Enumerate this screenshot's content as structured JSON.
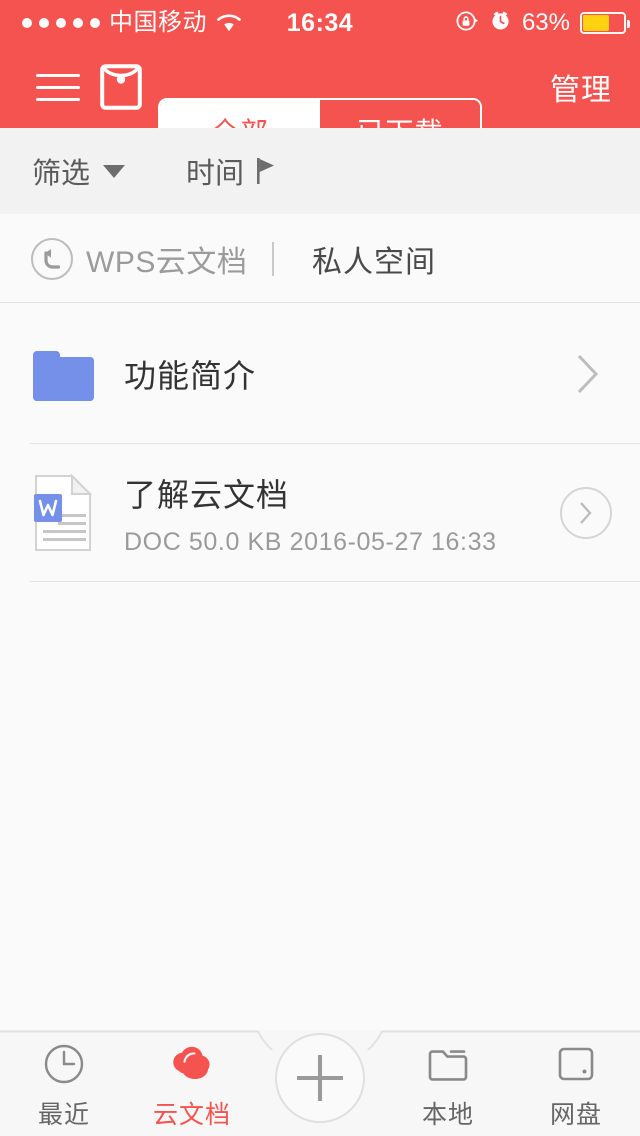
{
  "statusbar": {
    "carrier": "中国移动",
    "time": "16:34",
    "battery_percent": "63%",
    "signal_dots": 5,
    "battery_level": 63,
    "icons": [
      "wifi-icon",
      "rotation-lock-icon",
      "alarm-clock-icon",
      "battery-icon"
    ]
  },
  "navbar": {
    "menu_icon": "hamburger-menu-icon",
    "envelope_icon": "red-envelope-icon",
    "segments": [
      {
        "label": "全部",
        "selected": true
      },
      {
        "label": "已下载",
        "selected": false
      }
    ],
    "manage_label": "管理",
    "background": "#f5534f"
  },
  "filterbar": {
    "filter_label": "筛选",
    "sort_label": "时间"
  },
  "breadcrumb": {
    "back_icon": "back-arrow-icon",
    "root_label": "WPS云文档",
    "separator": "|",
    "current_label": "私人空间"
  },
  "list": {
    "items": [
      {
        "type": "folder",
        "icon": "blue-folder-icon",
        "title": "功能简介",
        "meta": "",
        "accessory": "chevron-right-icon"
      },
      {
        "type": "file",
        "icon": "word-document-icon",
        "title": "了解云文档",
        "meta": "DOC  50.0 KB  2016-05-27 16:33",
        "file_type": "DOC",
        "file_size": "50.0 KB",
        "modified": "2016-05-27 16:33",
        "accessory": "chevron-right-circle-icon"
      }
    ]
  },
  "tabbar": {
    "tabs": [
      {
        "label": "最近",
        "icon": "clock-icon",
        "active": false
      },
      {
        "label": "云文档",
        "icon": "cloud-icon",
        "active": true
      },
      {
        "label": "",
        "icon": "plus-icon",
        "active": false
      },
      {
        "label": "本地",
        "icon": "folder-icon",
        "active": false
      },
      {
        "label": "网盘",
        "icon": "cloud-drive-icon",
        "active": false
      }
    ],
    "accent_color": "#f5534f",
    "inactive_color": "#666666"
  }
}
